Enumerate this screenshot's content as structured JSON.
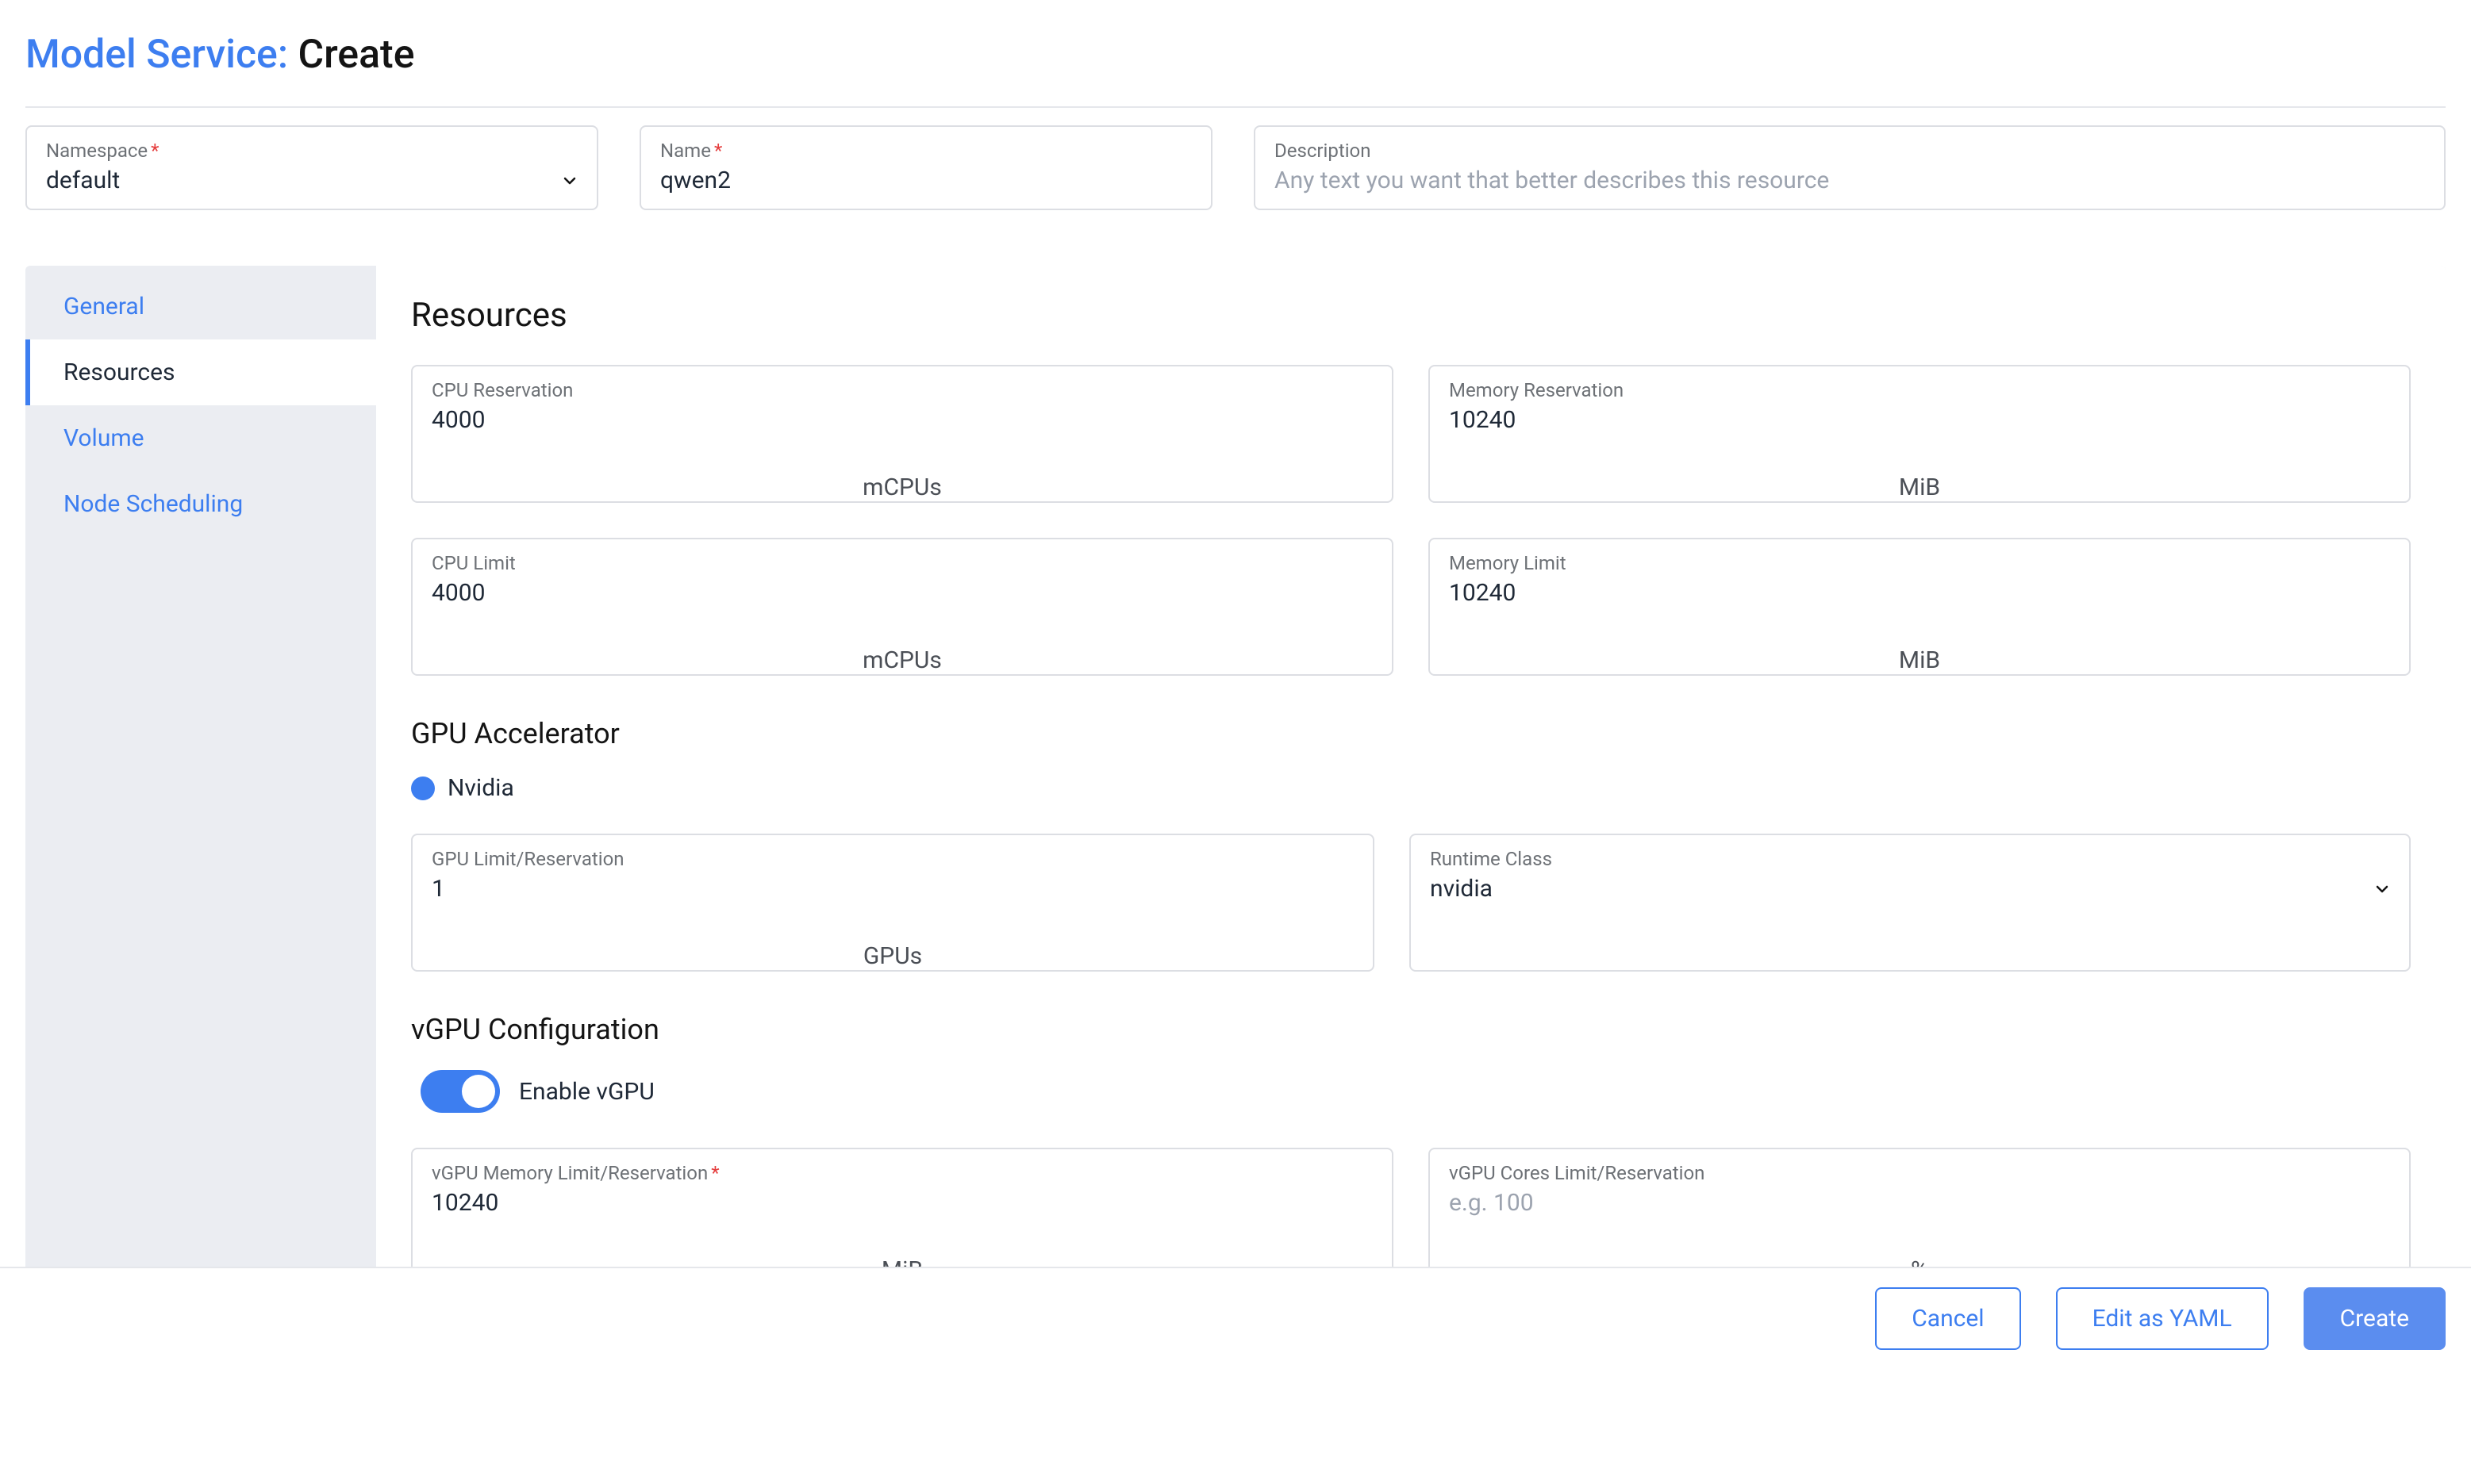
{
  "header": {
    "prefix": "Model Service:",
    "suffix": "Create"
  },
  "top": {
    "namespace": {
      "label": "Namespace",
      "value": "default"
    },
    "name": {
      "label": "Name",
      "value": "qwen2"
    },
    "description": {
      "label": "Description",
      "placeholder": "Any text you want that better describes this resource",
      "value": ""
    }
  },
  "tabs": [
    {
      "key": "general",
      "label": "General",
      "active": false
    },
    {
      "key": "resources",
      "label": "Resources",
      "active": true
    },
    {
      "key": "volume",
      "label": "Volume",
      "active": false
    },
    {
      "key": "node-scheduling",
      "label": "Node Scheduling",
      "active": false
    }
  ],
  "resources": {
    "title": "Resources",
    "cpu_reservation": {
      "label": "CPU Reservation",
      "value": "4000",
      "unit": "mCPUs"
    },
    "memory_reservation": {
      "label": "Memory Reservation",
      "value": "10240",
      "unit": "MiB"
    },
    "cpu_limit": {
      "label": "CPU Limit",
      "value": "4000",
      "unit": "mCPUs"
    },
    "memory_limit": {
      "label": "Memory Limit",
      "value": "10240",
      "unit": "MiB"
    },
    "gpu_title": "GPU Accelerator",
    "gpu_vendor": "Nvidia",
    "gpu_limit": {
      "label": "GPU Limit/Reservation",
      "value": "1",
      "unit": "GPUs"
    },
    "runtime_class": {
      "label": "Runtime Class",
      "value": "nvidia"
    },
    "vgpu_title": "vGPU Configuration",
    "vgpu_enable_label": "Enable vGPU",
    "vgpu_enabled": true,
    "vgpu_mem": {
      "label": "vGPU Memory Limit/Reservation",
      "value": "10240",
      "unit": "MiB"
    },
    "vgpu_cores": {
      "label": "vGPU Cores Limit/Reservation",
      "placeholder": "e.g. 100",
      "value": "",
      "unit": "%"
    }
  },
  "footer": {
    "cancel": "Cancel",
    "edit_yaml": "Edit as YAML",
    "create": "Create"
  }
}
